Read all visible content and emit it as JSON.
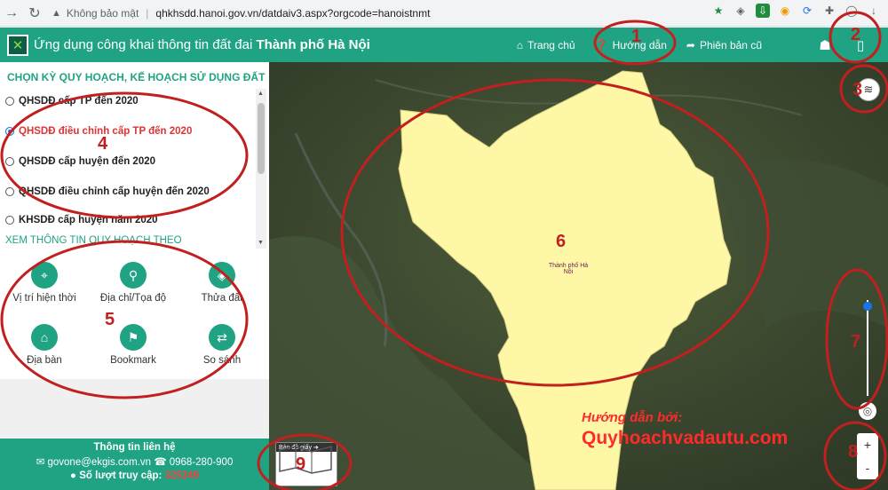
{
  "browser": {
    "security": "Không bảo mật",
    "url": "qhkhsdd.hanoi.gov.vn/datdaiv3.aspx?orgcode=hanoistnmt"
  },
  "header": {
    "title_prefix": "Ứng dụng công khai thông tin đất đai",
    "title_city": "Thành phố Hà Nội",
    "menu": {
      "home": "Trang chủ",
      "guide": "Hướng dẫn",
      "old_version": "Phiên bản cũ"
    }
  },
  "panel": {
    "title": "CHỌN KỲ QUY HOẠCH, KẾ HOẠCH SỬ DỤNG ĐẤT",
    "options": [
      "QHSDĐ cấp TP đến 2020",
      "QHSDĐ điều chỉnh cấp TP đến 2020",
      "QHSDĐ cấp huyện đến 2020",
      "QHSDĐ điều chỉnh cấp huyện đến 2020",
      "KHSDĐ cấp huyện năm 2020"
    ],
    "selected_index": 1,
    "section_title": "XEM THÔNG TIN QUY HOẠCH THEO",
    "tools": {
      "current_location": "Vị trí hiện thời",
      "address": "Địa chỉ/Tọa độ",
      "parcel": "Thửa đất",
      "area": "Địa bàn",
      "bookmark": "Bookmark",
      "compare": "So sánh"
    }
  },
  "footer": {
    "title": "Thông tin liên hệ",
    "email": "govone@ekgis.com.vn",
    "phone": "0968-280-900",
    "visits_label": "Số lượt truy cập:",
    "visits_count": "325349"
  },
  "map": {
    "region_label_line1": "Thành phố Hà",
    "region_label_line2": "Nội",
    "paper_map_label": "Bản đồ giấy",
    "watermark_line1": "Hướng dẫn bởi:",
    "watermark_line2": "Quyhoachvadautu.com",
    "zoom_in": "+",
    "zoom_out": "-"
  },
  "annotations": [
    "1",
    "2",
    "3",
    "4",
    "5",
    "6",
    "7",
    "8",
    "9"
  ],
  "colors": {
    "brand": "#1fa383",
    "selected_text": "#dd3333",
    "annotation": "#c21f1f",
    "region_fill": "#fdf7a6"
  }
}
